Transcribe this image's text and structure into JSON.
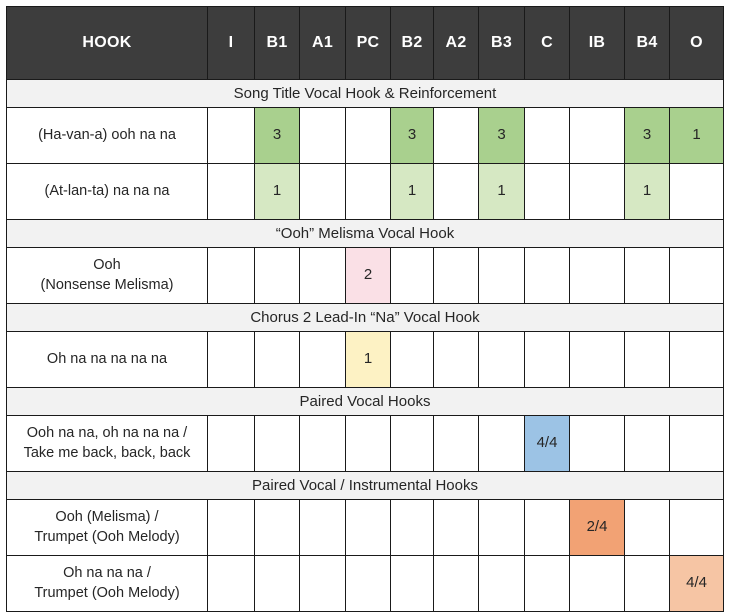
{
  "table": {
    "columns": [
      {
        "key": "hook",
        "label": "HOOK"
      },
      {
        "key": "I",
        "label": "I"
      },
      {
        "key": "B1",
        "label": "B1"
      },
      {
        "key": "A1",
        "label": "A1"
      },
      {
        "key": "PC",
        "label": "PC"
      },
      {
        "key": "B2",
        "label": "B2"
      },
      {
        "key": "A2",
        "label": "A2"
      },
      {
        "key": "B3",
        "label": "B3"
      },
      {
        "key": "C",
        "label": "C"
      },
      {
        "key": "IB",
        "label": "IB"
      },
      {
        "key": "B4",
        "label": "B4"
      },
      {
        "key": "O",
        "label": "O"
      }
    ],
    "colors": {
      "header_bg": "#3d3d3d",
      "header_text": "#ffffff",
      "section_bg": "#f2f2f2",
      "cell_bg": "#ffffff",
      "border": "#1a1a1a",
      "green_dark": "#a9d08e",
      "green_light": "#d6e8c3",
      "pink": "#fae0e6",
      "yellow": "#fdf2c4",
      "blue": "#9cc3e5",
      "orange_dark": "#f2a274",
      "orange_light": "#f6c5a4"
    },
    "sections": [
      {
        "title": "Song Title Vocal Hook & Reinforcement",
        "rows": [
          {
            "label_lines": [
              "(Ha-van-a) ooh na na"
            ],
            "cells": [
              {
                "col": "I",
                "value": "",
                "color": ""
              },
              {
                "col": "B1",
                "value": "3",
                "color": "#a9d08e"
              },
              {
                "col": "A1",
                "value": "",
                "color": ""
              },
              {
                "col": "PC",
                "value": "",
                "color": ""
              },
              {
                "col": "B2",
                "value": "3",
                "color": "#a9d08e"
              },
              {
                "col": "A2",
                "value": "",
                "color": ""
              },
              {
                "col": "B3",
                "value": "3",
                "color": "#a9d08e"
              },
              {
                "col": "C",
                "value": "",
                "color": ""
              },
              {
                "col": "IB",
                "value": "",
                "color": ""
              },
              {
                "col": "B4",
                "value": "3",
                "color": "#a9d08e"
              },
              {
                "col": "O",
                "value": "1",
                "color": "#a9d08e"
              }
            ]
          },
          {
            "label_lines": [
              "(At-lan-ta) na na na"
            ],
            "cells": [
              {
                "col": "I",
                "value": "",
                "color": ""
              },
              {
                "col": "B1",
                "value": "1",
                "color": "#d6e8c3"
              },
              {
                "col": "A1",
                "value": "",
                "color": ""
              },
              {
                "col": "PC",
                "value": "",
                "color": ""
              },
              {
                "col": "B2",
                "value": "1",
                "color": "#d6e8c3"
              },
              {
                "col": "A2",
                "value": "",
                "color": ""
              },
              {
                "col": "B3",
                "value": "1",
                "color": "#d6e8c3"
              },
              {
                "col": "C",
                "value": "",
                "color": ""
              },
              {
                "col": "IB",
                "value": "",
                "color": ""
              },
              {
                "col": "B4",
                "value": "1",
                "color": "#d6e8c3"
              },
              {
                "col": "O",
                "value": "",
                "color": ""
              }
            ]
          }
        ]
      },
      {
        "title": "“Ooh” Melisma Vocal Hook",
        "rows": [
          {
            "label_lines": [
              "Ooh",
              "(Nonsense Melisma)"
            ],
            "cells": [
              {
                "col": "I",
                "value": "",
                "color": ""
              },
              {
                "col": "B1",
                "value": "",
                "color": ""
              },
              {
                "col": "A1",
                "value": "",
                "color": ""
              },
              {
                "col": "PC",
                "value": "2",
                "color": "#fae0e6"
              },
              {
                "col": "B2",
                "value": "",
                "color": ""
              },
              {
                "col": "A2",
                "value": "",
                "color": ""
              },
              {
                "col": "B3",
                "value": "",
                "color": ""
              },
              {
                "col": "C",
                "value": "",
                "color": ""
              },
              {
                "col": "IB",
                "value": "",
                "color": ""
              },
              {
                "col": "B4",
                "value": "",
                "color": ""
              },
              {
                "col": "O",
                "value": "",
                "color": ""
              }
            ]
          }
        ]
      },
      {
        "title": "Chorus 2 Lead-In “Na” Vocal Hook",
        "rows": [
          {
            "label_lines": [
              "Oh na na na na na"
            ],
            "cells": [
              {
                "col": "I",
                "value": "",
                "color": ""
              },
              {
                "col": "B1",
                "value": "",
                "color": ""
              },
              {
                "col": "A1",
                "value": "",
                "color": ""
              },
              {
                "col": "PC",
                "value": "1",
                "color": "#fdf2c4"
              },
              {
                "col": "B2",
                "value": "",
                "color": ""
              },
              {
                "col": "A2",
                "value": "",
                "color": ""
              },
              {
                "col": "B3",
                "value": "",
                "color": ""
              },
              {
                "col": "C",
                "value": "",
                "color": ""
              },
              {
                "col": "IB",
                "value": "",
                "color": ""
              },
              {
                "col": "B4",
                "value": "",
                "color": ""
              },
              {
                "col": "O",
                "value": "",
                "color": ""
              }
            ]
          }
        ]
      },
      {
        "title": "Paired Vocal Hooks",
        "rows": [
          {
            "label_lines": [
              "Ooh na na, oh na na na /",
              "Take me back, back, back"
            ],
            "cells": [
              {
                "col": "I",
                "value": "",
                "color": ""
              },
              {
                "col": "B1",
                "value": "",
                "color": ""
              },
              {
                "col": "A1",
                "value": "",
                "color": ""
              },
              {
                "col": "PC",
                "value": "",
                "color": ""
              },
              {
                "col": "B2",
                "value": "",
                "color": ""
              },
              {
                "col": "A2",
                "value": "",
                "color": ""
              },
              {
                "col": "B3",
                "value": "",
                "color": ""
              },
              {
                "col": "C",
                "value": "4/4",
                "color": "#9cc3e5"
              },
              {
                "col": "IB",
                "value": "",
                "color": ""
              },
              {
                "col": "B4",
                "value": "",
                "color": ""
              },
              {
                "col": "O",
                "value": "",
                "color": ""
              }
            ]
          }
        ]
      },
      {
        "title": "Paired Vocal / Instrumental Hooks",
        "rows": [
          {
            "label_lines": [
              "Ooh (Melisma) /",
              "Trumpet (Ooh Melody)"
            ],
            "cells": [
              {
                "col": "I",
                "value": "",
                "color": ""
              },
              {
                "col": "B1",
                "value": "",
                "color": ""
              },
              {
                "col": "A1",
                "value": "",
                "color": ""
              },
              {
                "col": "PC",
                "value": "",
                "color": ""
              },
              {
                "col": "B2",
                "value": "",
                "color": ""
              },
              {
                "col": "A2",
                "value": "",
                "color": ""
              },
              {
                "col": "B3",
                "value": "",
                "color": ""
              },
              {
                "col": "C",
                "value": "",
                "color": ""
              },
              {
                "col": "IB",
                "value": "2/4",
                "color": "#f2a274"
              },
              {
                "col": "B4",
                "value": "",
                "color": ""
              },
              {
                "col": "O",
                "value": "",
                "color": ""
              }
            ]
          },
          {
            "label_lines": [
              "Oh na na na /",
              "Trumpet (Ooh Melody)"
            ],
            "cells": [
              {
                "col": "I",
                "value": "",
                "color": ""
              },
              {
                "col": "B1",
                "value": "",
                "color": ""
              },
              {
                "col": "A1",
                "value": "",
                "color": ""
              },
              {
                "col": "PC",
                "value": "",
                "color": ""
              },
              {
                "col": "B2",
                "value": "",
                "color": ""
              },
              {
                "col": "A2",
                "value": "",
                "color": ""
              },
              {
                "col": "B3",
                "value": "",
                "color": ""
              },
              {
                "col": "C",
                "value": "",
                "color": ""
              },
              {
                "col": "IB",
                "value": "",
                "color": ""
              },
              {
                "col": "B4",
                "value": "",
                "color": ""
              },
              {
                "col": "O",
                "value": "4/4",
                "color": "#f6c5a4"
              }
            ]
          }
        ]
      }
    ]
  }
}
